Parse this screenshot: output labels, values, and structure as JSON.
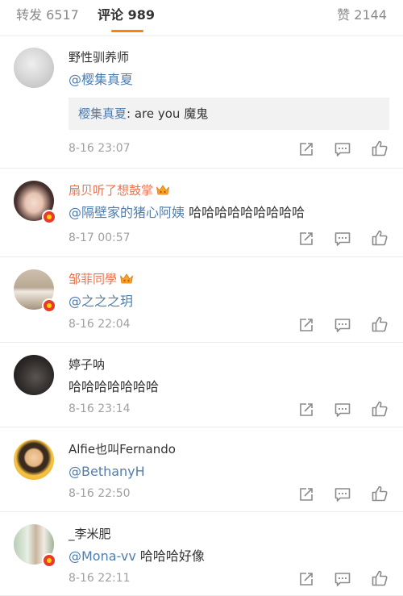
{
  "tabs": {
    "repost_label": "转发",
    "repost_count": "6517",
    "comments_label": "评论",
    "comments_count": "989",
    "likes_label": "赞",
    "likes_count": "2144",
    "active_tab": "comments"
  },
  "colors": {
    "accent": "#ff8200",
    "mention": "#507daf",
    "vip_name": "#eb7350",
    "timestamp": "#a0a0a0",
    "badge": "#e8392b"
  },
  "comments": [
    {
      "username": "野性驯养师",
      "mention": "@樱集真夏",
      "text": "",
      "quote_user": "樱集真夏",
      "quote_text": ": are you 魔鬼",
      "timestamp": "8-16 23:07"
    },
    {
      "username": "扇贝听了想鼓掌",
      "mention": "@隔壁家的猪心阿姨",
      "text": " 哈哈哈哈哈哈哈哈哈",
      "timestamp": "8-17 00:57"
    },
    {
      "username": "邹菲同學",
      "mention": "@之之之玥",
      "text": "",
      "timestamp": "8-16 22:04"
    },
    {
      "username": "婷子呐",
      "mention": "",
      "text": "哈哈哈哈哈哈哈",
      "timestamp": "8-16 23:14"
    },
    {
      "username": "Alfie也叫Fernando",
      "mention": "@BethanyH",
      "text": "",
      "timestamp": "8-16 22:50"
    },
    {
      "username": "_李米肥",
      "mention": "@Mona-vv",
      "text": " 哈哈哈好像",
      "timestamp": "8-16 22:11"
    }
  ],
  "icons": {
    "repost": "share-icon",
    "reply": "comment-icon",
    "like": "thumbs-up-icon",
    "vip": "vip-crown-icon",
    "verified": "verified-badge-icon"
  }
}
